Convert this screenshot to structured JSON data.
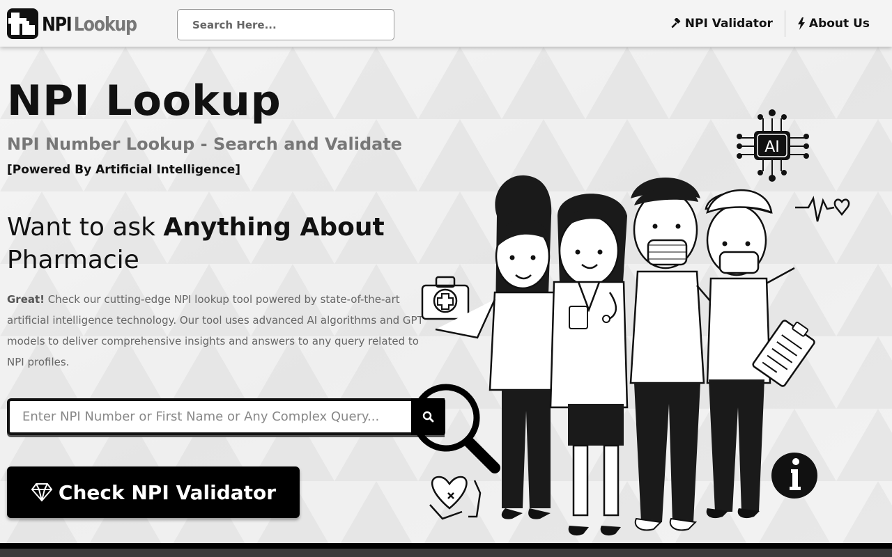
{
  "header": {
    "logo_npi": "NPI",
    "logo_lookup": "Lookup",
    "search_placeholder": "Search Here...",
    "nav": [
      {
        "label": "NPI Validator",
        "icon": "gavel-icon"
      },
      {
        "label": "About Us",
        "icon": "bolt-icon"
      }
    ]
  },
  "hero": {
    "title": "NPI Lookup",
    "subtitle": "NPI Number Lookup - Search and Validate",
    "powered": "[Powered By Artificial Intelligence]",
    "ask_prefix": "Want to ask ",
    "ask_bold": "Anything About",
    "ask_topic": "Pharmacie",
    "desc_bold": "Great!",
    "desc_text": " Check our cutting-edge NPI lookup tool powered by state-of-the-art artificial intelligence technology. Our tool uses advanced AI algorithms and GPT models to deliver comprehensive insights and answers to any query related to NPI profiles.",
    "query_placeholder": "Enter NPI Number or First Name or Any Complex Query...",
    "cta_label": "Check NPI Validator"
  },
  "illustration": {
    "ai_chip_label": "AI"
  },
  "colors": {
    "primary": "#000000",
    "muted_text": "#777777",
    "background": "#ececec"
  }
}
